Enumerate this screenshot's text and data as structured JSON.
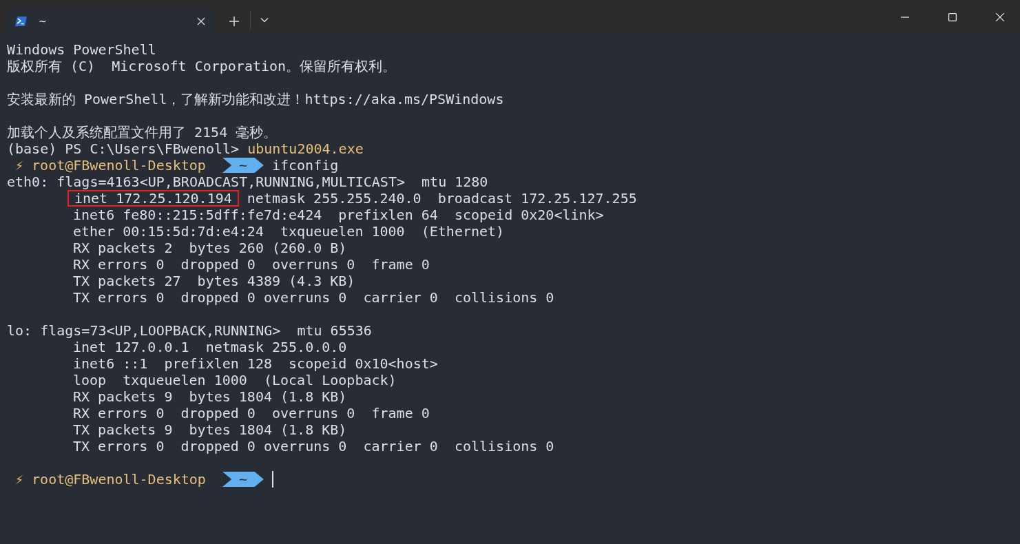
{
  "tabs": [
    {
      "title": "~",
      "selected": true
    }
  ],
  "lines": [
    {
      "kind": "plain",
      "text": "Windows PowerShell"
    },
    {
      "kind": "plain",
      "text": "版权所有 (C)  Microsoft Corporation。保留所有权利。"
    },
    {
      "kind": "blank"
    },
    {
      "kind": "plain",
      "text": "安装最新的 PowerShell，了解新功能和改进！https://aka.ms/PSWindows"
    },
    {
      "kind": "blank"
    },
    {
      "kind": "plain",
      "text": "加载个人及系统配置文件用了 2154 毫秒。"
    },
    {
      "kind": "ps-prompt",
      "prompt": "(base) PS C:\\Users\\FBwenoll>",
      "command": "ubuntu2004.exe"
    },
    {
      "kind": "zsh-prompt",
      "symbol": "⚡",
      "user": "root@FBwenoll-Desktop",
      "dir": "~",
      "command": "ifconfig",
      "cursor": false
    },
    {
      "kind": "plain",
      "text": "eth0: flags=4163<UP,BROADCAST,RUNNING,MULTICAST>  mtu 1280"
    },
    {
      "kind": "highlight",
      "boxed": "inet 172.25.120.194",
      "text": "netmask 255.255.240.0  broadcast 172.25.127.255"
    },
    {
      "kind": "indented",
      "text": "inet6 fe80::215:5dff:fe7d:e424  prefixlen 64  scopeid 0x20<link>"
    },
    {
      "kind": "indented",
      "text": "ether 00:15:5d:7d:e4:24  txqueuelen 1000  (Ethernet)"
    },
    {
      "kind": "indented",
      "text": "RX packets 2  bytes 260 (260.0 B)"
    },
    {
      "kind": "indented",
      "text": "RX errors 0  dropped 0  overruns 0  frame 0"
    },
    {
      "kind": "indented",
      "text": "TX packets 27  bytes 4389 (4.3 KB)"
    },
    {
      "kind": "indented",
      "text": "TX errors 0  dropped 0 overruns 0  carrier 0  collisions 0"
    },
    {
      "kind": "blank"
    },
    {
      "kind": "plain",
      "text": "lo: flags=73<UP,LOOPBACK,RUNNING>  mtu 65536"
    },
    {
      "kind": "indented",
      "text": "inet 127.0.0.1  netmask 255.0.0.0"
    },
    {
      "kind": "indented",
      "text": "inet6 ::1  prefixlen 128  scopeid 0x10<host>"
    },
    {
      "kind": "indented",
      "text": "loop  txqueuelen 1000  (Local Loopback)"
    },
    {
      "kind": "indented",
      "text": "RX packets 9  bytes 1804 (1.8 KB)"
    },
    {
      "kind": "indented",
      "text": "RX errors 0  dropped 0  overruns 0  frame 0"
    },
    {
      "kind": "indented",
      "text": "TX packets 9  bytes 1804 (1.8 KB)"
    },
    {
      "kind": "indented",
      "text": "TX errors 0  dropped 0 overruns 0  carrier 0  collisions 0"
    },
    {
      "kind": "blank"
    },
    {
      "kind": "zsh-prompt",
      "symbol": "⚡",
      "user": "root@FBwenoll-Desktop",
      "dir": "~",
      "cursor": true
    }
  ]
}
